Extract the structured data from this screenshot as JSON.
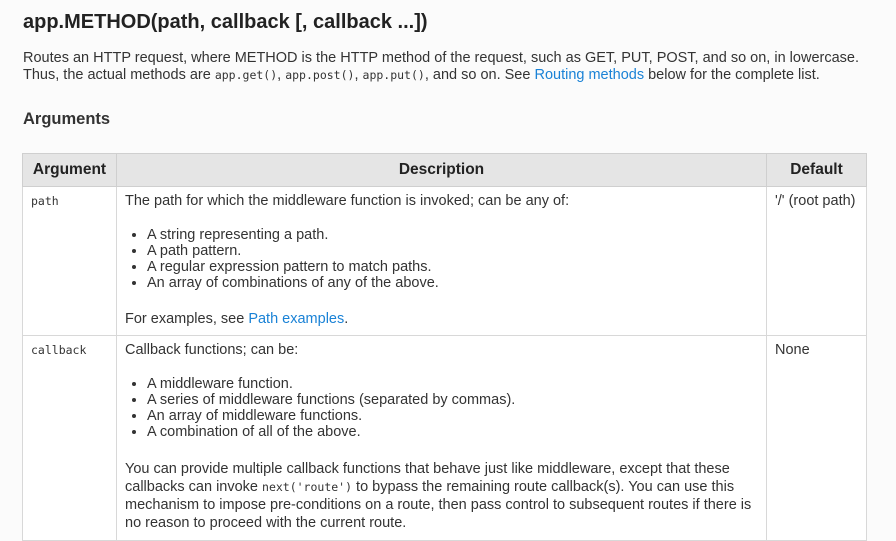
{
  "heading": "app.METHOD(path, callback [, callback ...])",
  "intro": {
    "line_part1": "Routes an HTTP request, where METHOD is the HTTP method of the request, such as GET, PUT, POST, and so on, in lowercase. Thus, the actual methods are ",
    "code_get": "app.get()",
    "sep1": ", ",
    "code_post": "app.post()",
    "sep2": ", ",
    "code_put": "app.put()",
    "part2": ", and so on. See ",
    "link_routing": "Routing methods",
    "part3": " below for the complete list."
  },
  "arguments_heading": "Arguments",
  "table": {
    "headers": [
      "Argument",
      "Description",
      "Default"
    ],
    "rows": [
      {
        "argument": "path",
        "description_intro": "The path for which the middleware function is invoked; can be any of:",
        "bullets": [
          "A string representing a path.",
          "A path pattern.",
          "A regular expression pattern to match paths.",
          "An array of combinations of any of the above."
        ],
        "after_text": "For examples, see ",
        "after_link": "Path examples",
        "after_end": ".",
        "default": "'/' (root path)"
      },
      {
        "argument": "callback",
        "description_intro": "Callback functions; can be:",
        "bullets": [
          "A middleware function.",
          "A series of middleware functions (separated by commas).",
          "An array of middleware functions.",
          "A combination of all of the above."
        ],
        "after_part1": "You can provide multiple callback functions that behave just like middleware, except that these callbacks can invoke ",
        "after_code": "next('route')",
        "after_part2": " to bypass the remaining route callback(s). You can use this mechanism to impose pre-conditions on a route, then pass control to subsequent routes if there is no reason to proceed with the current route.",
        "default": "None"
      }
    ]
  }
}
